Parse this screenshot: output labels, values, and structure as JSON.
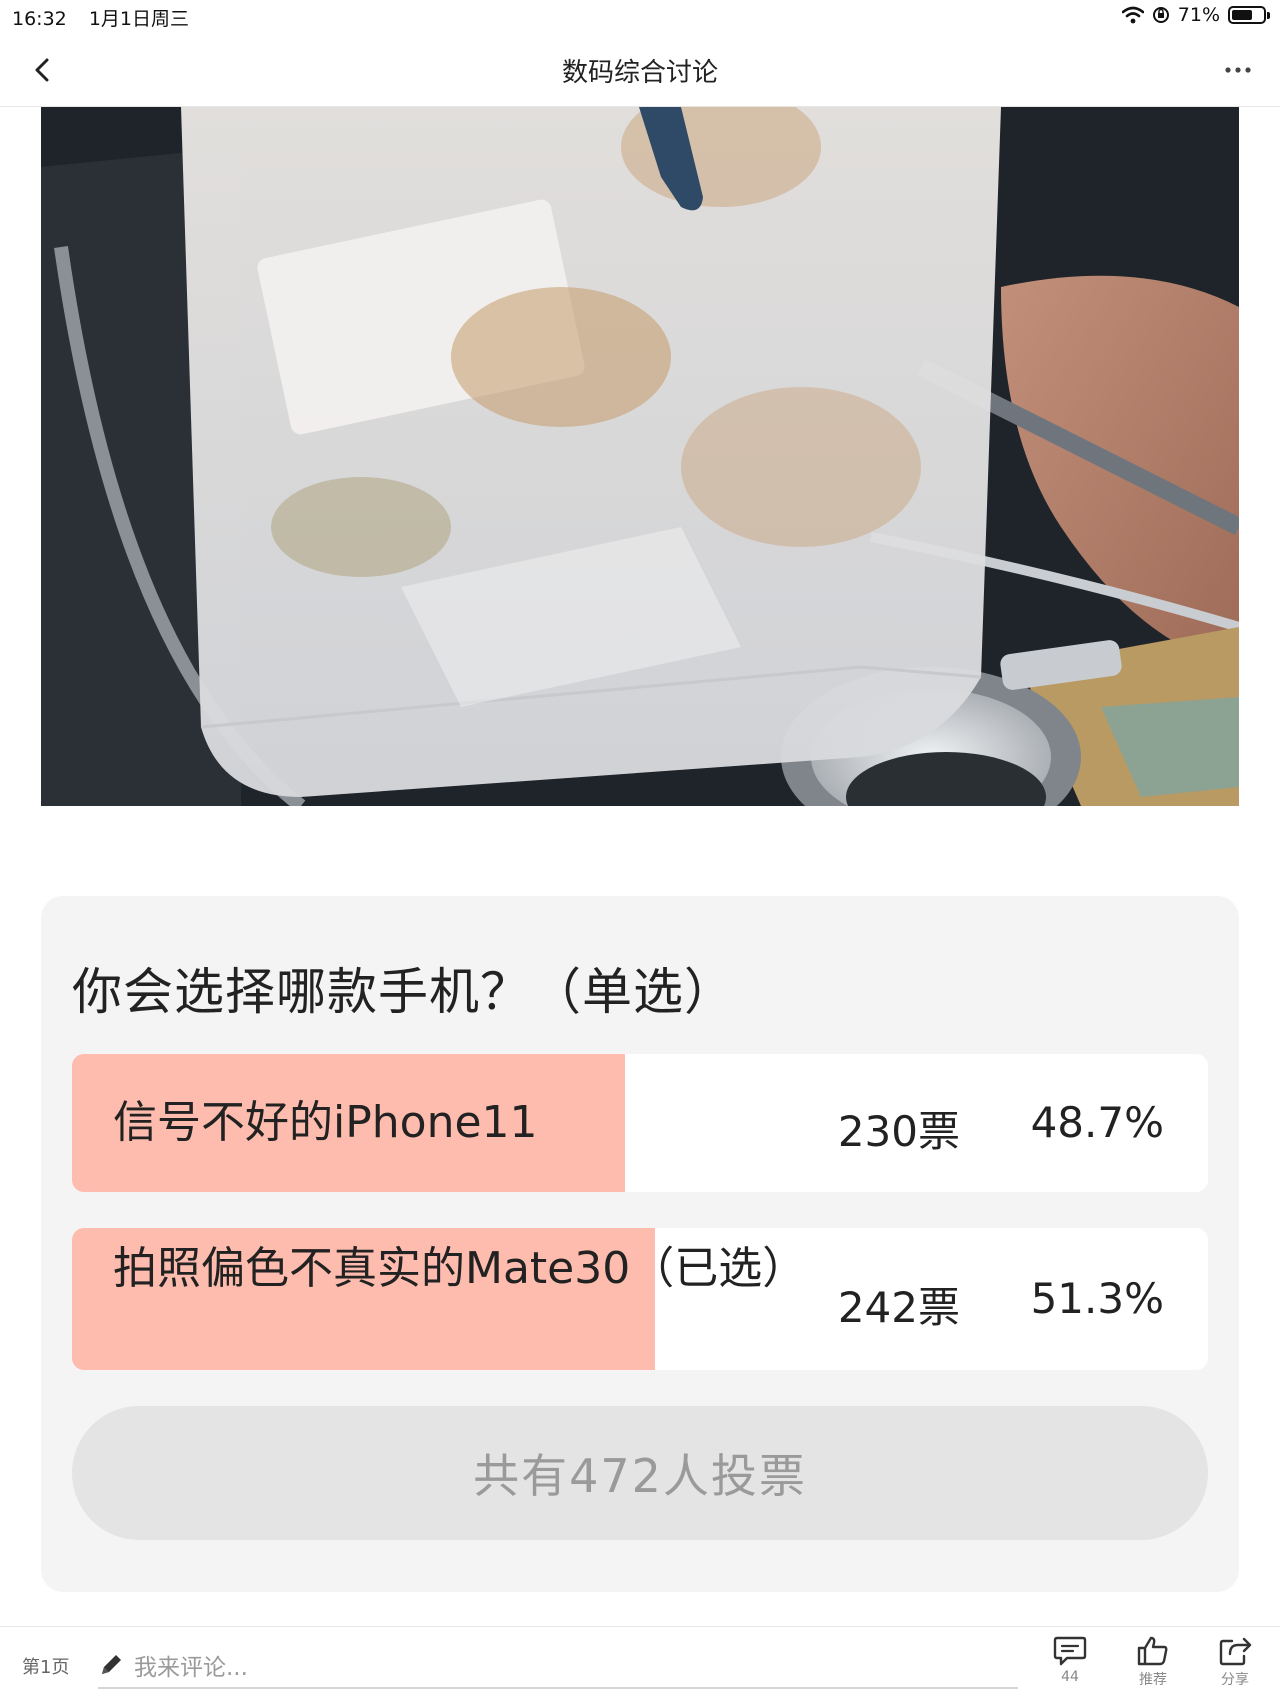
{
  "status_bar": {
    "time": "16:32",
    "date": "1月1日周三",
    "battery_percent": "71%",
    "battery_level": 0.71
  },
  "nav": {
    "title": "数码综合讨论",
    "back_icon": "chevron-left-icon",
    "more_icon": "more-dots-icon"
  },
  "poll": {
    "question": "你会选择哪款手机？（单选）",
    "options": [
      {
        "label": "信号不好的iPhone11",
        "votes": "230票",
        "percent": "48.7%",
        "fraction": 0.487,
        "selected": false
      },
      {
        "label": "拍照偏色不真实的Mate30（已选）",
        "votes": "242票",
        "percent": "51.3%",
        "fraction": 0.513,
        "selected": true
      }
    ],
    "total": "共有472人投票",
    "fill_color": "#fdbcad"
  },
  "bottom_bar": {
    "page": "第1页",
    "comment_placeholder": "我来评论...",
    "comments_count": "44",
    "like_label": "推荐",
    "share_label": "分享"
  }
}
